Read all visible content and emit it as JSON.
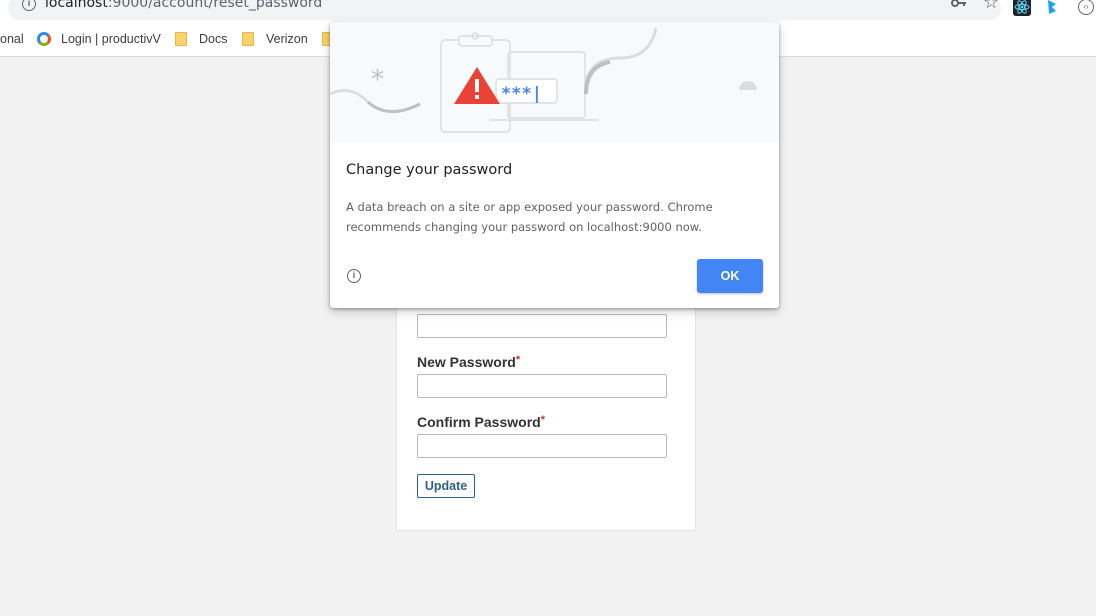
{
  "browser": {
    "url_host": "localhost",
    "url_rest": ":9000/account/reset_password"
  },
  "bookmarks": [
    {
      "label": "onal"
    },
    {
      "label": "Login | productivV"
    },
    {
      "label": "Docs"
    },
    {
      "label": "Verizon"
    }
  ],
  "form": {
    "new_password_label": "New Password",
    "confirm_password_label": "Confirm Password",
    "required_mark": "*",
    "current_password_value": "",
    "new_password_value": "",
    "confirm_password_value": "",
    "update_label": "Update"
  },
  "dialog": {
    "illustration_text": "***|",
    "title": "Change your password",
    "body": "A data breach on a site or app exposed your password. Chrome recommends changing your password on localhost:9000 now.",
    "ok_label": "OK"
  },
  "colors": {
    "accent": "#4285f4",
    "warning": "#ea4335",
    "form_button": "#2c5f8a",
    "required": "#c0392b"
  }
}
